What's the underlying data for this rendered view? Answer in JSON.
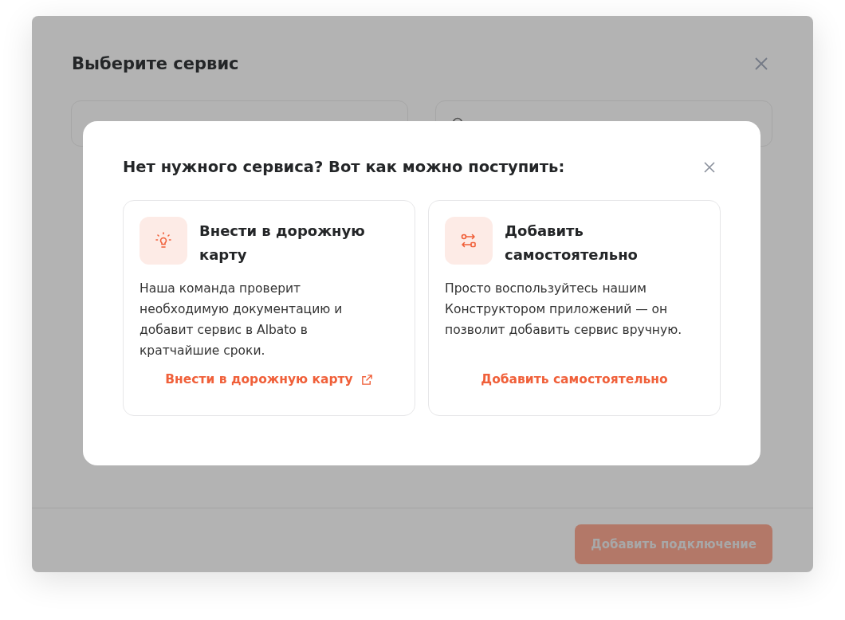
{
  "dialog": {
    "title": "Выберите сервис",
    "footer_button": {
      "label": "Добавить подключение",
      "disabled": true
    }
  },
  "modal": {
    "title": "Нет нужного сервиса? Вот как можно поступить:",
    "options": [
      {
        "kind": "roadmap",
        "title": "Внести в дорожную карту",
        "text": "Наша команда проверит необходимую документацию и добавит сервис в Albato в кратчайшие сроки.",
        "link": "Внести в дорожную карту",
        "external": true
      },
      {
        "kind": "builder",
        "title": "Добавить самостоятельно",
        "text": "Просто воспользуйтесь нашим Конструктором приложений — он позволит добавить сервис вручную.",
        "link": "Добавить самостоятельно",
        "external": false
      }
    ]
  }
}
